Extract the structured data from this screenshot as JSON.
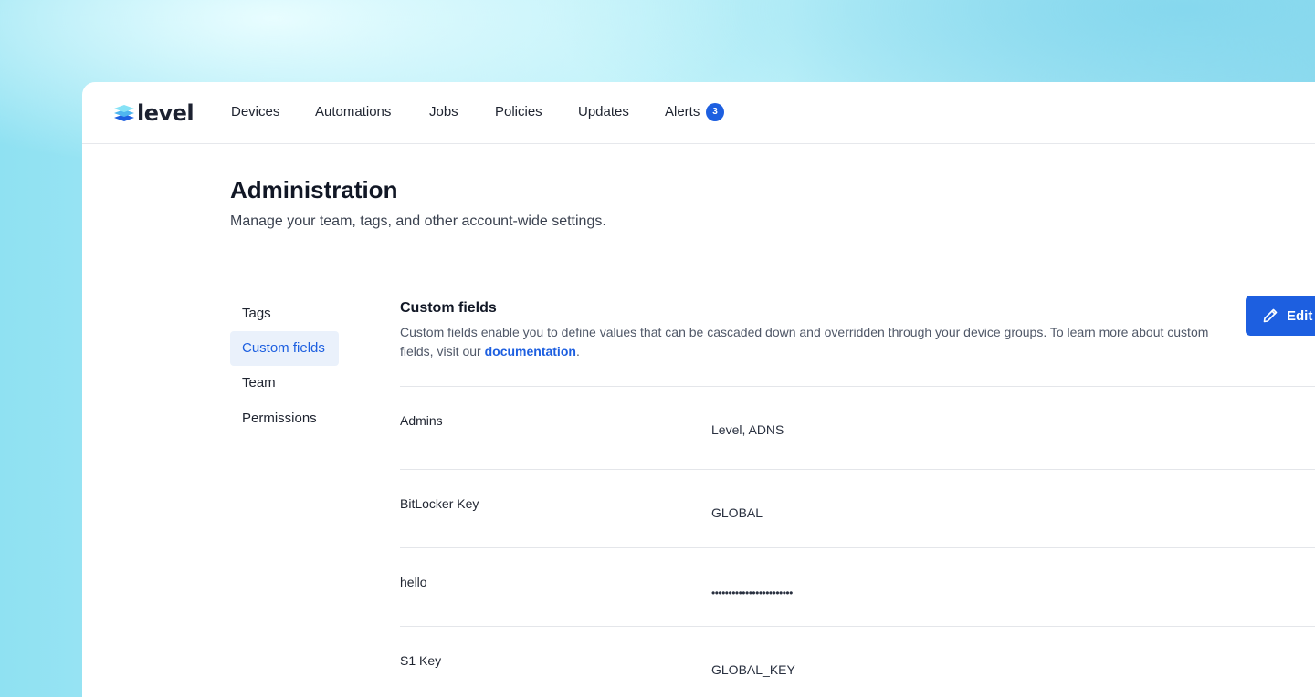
{
  "logo": {
    "text": "level"
  },
  "nav": {
    "items": [
      {
        "label": "Devices"
      },
      {
        "label": "Automations"
      },
      {
        "label": "Jobs"
      },
      {
        "label": "Policies"
      },
      {
        "label": "Updates"
      },
      {
        "label": "Alerts"
      }
    ],
    "alerts_count": "3"
  },
  "page": {
    "title": "Administration",
    "subtitle": "Manage your team, tags, and other account-wide settings."
  },
  "sidebar": {
    "items": [
      {
        "label": "Tags"
      },
      {
        "label": "Custom fields",
        "active": true
      },
      {
        "label": "Team"
      },
      {
        "label": "Permissions"
      }
    ]
  },
  "section": {
    "title": "Custom fields",
    "description_prefix": "Custom fields enable you to define values that can be cascaded down and overridden through your device groups. To learn more about custom fields, visit our ",
    "link_text": "documentation",
    "description_suffix": ".",
    "edit_label": "Edit"
  },
  "fields": [
    {
      "name": "Admins",
      "value": "Level, ADNS"
    },
    {
      "name": "BitLocker Key",
      "value": "GLOBAL"
    },
    {
      "name": "hello",
      "value": "••••••••••••••••••••••••"
    },
    {
      "name": "S1 Key",
      "value": "GLOBAL_KEY"
    }
  ],
  "colors": {
    "accent": "#1d5fe0",
    "active_bg": "#eaf1fb"
  }
}
